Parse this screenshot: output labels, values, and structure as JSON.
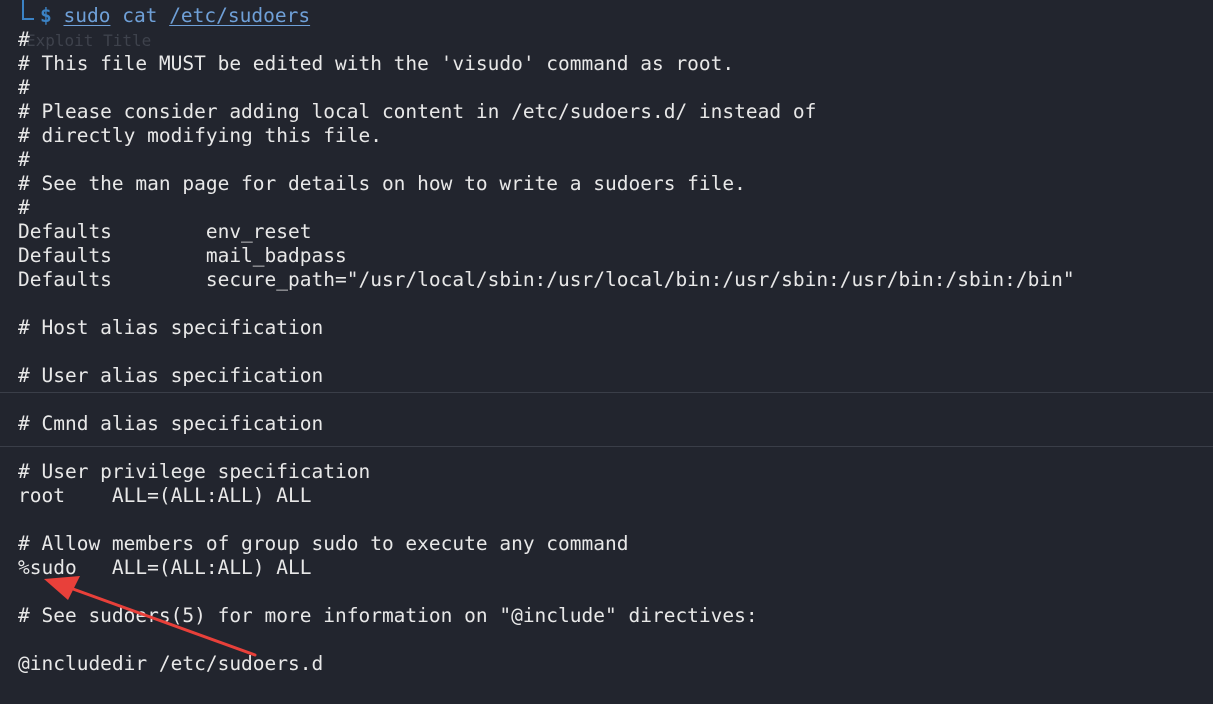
{
  "prompt": {
    "command": "sudo",
    "space": " ",
    "arg1": "cat",
    "arg2": "/etc/sudoers"
  },
  "lines": [
    "#",
    "# This file MUST be edited with the 'visudo' command as root.",
    "#",
    "# Please consider adding local content in /etc/sudoers.d/ instead of",
    "# directly modifying this file.",
    "#",
    "# See the man page for details on how to write a sudoers file.",
    "#",
    "Defaults        env_reset",
    "Defaults        mail_badpass",
    "Defaults        secure_path=\"/usr/local/sbin:/usr/local/bin:/usr/sbin:/usr/bin:/sbin:/bin\"",
    "",
    "# Host alias specification",
    "",
    "# User alias specification",
    "",
    "# Cmnd alias specification",
    "",
    "# User privilege specification",
    "root    ALL=(ALL:ALL) ALL",
    "",
    "# Allow members of group sudo to execute any command",
    "%sudo   ALL=(ALL:ALL) ALL",
    "",
    "# See sudoers(5) for more information on \"@include\" directives:",
    "",
    "@includedir /etc/sudoers.d"
  ],
  "annotation_color": "#e8403a"
}
